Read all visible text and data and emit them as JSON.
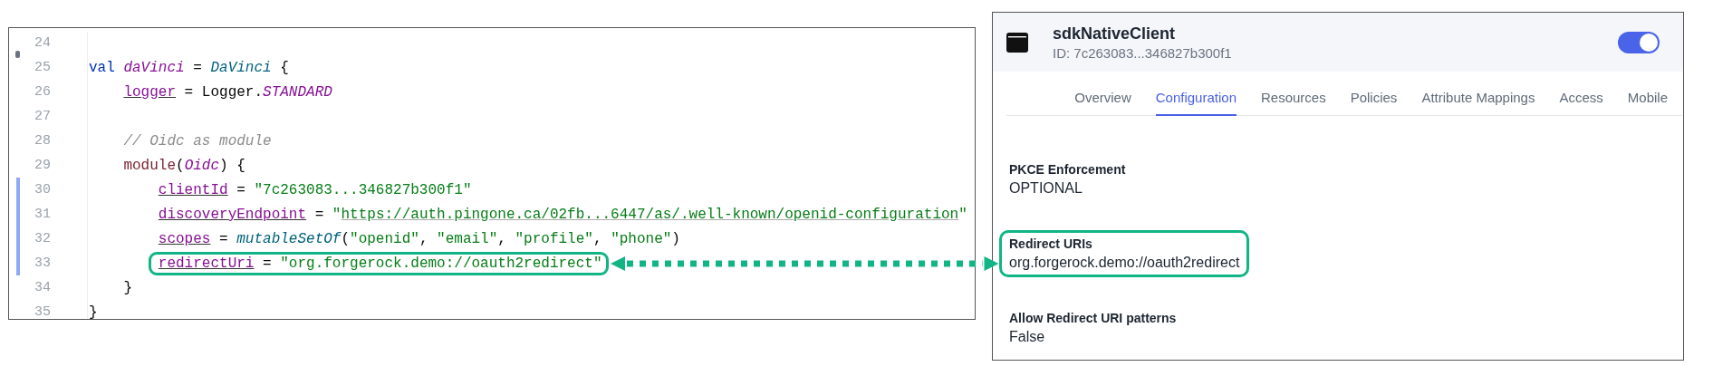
{
  "editor": {
    "lines": [
      {
        "number": "24",
        "changed": false,
        "highlighted": false
      },
      {
        "number": "25",
        "changed": false,
        "highlighted": false,
        "tokens": [
          {
            "kind": "keyword",
            "text": "val "
          },
          {
            "kind": "variable",
            "text": "daVinci"
          },
          {
            "kind": "plain",
            "text": " = "
          },
          {
            "kind": "call",
            "text": "DaVinci"
          },
          {
            "kind": "plain",
            "text": " {"
          }
        ]
      },
      {
        "number": "26",
        "changed": false,
        "highlighted": false,
        "tokens": [
          {
            "kind": "property",
            "text": "logger"
          },
          {
            "kind": "plain",
            "text": " = Logger."
          },
          {
            "kind": "constant",
            "text": "STANDARD"
          }
        ]
      },
      {
        "number": "27",
        "changed": false,
        "highlighted": false
      },
      {
        "number": "28",
        "changed": false,
        "highlighted": false,
        "tokens": [
          {
            "kind": "comment",
            "text": "// Oidc as module"
          }
        ]
      },
      {
        "number": "29",
        "changed": false,
        "highlighted": false,
        "tokens": [
          {
            "kind": "function",
            "text": "module"
          },
          {
            "kind": "plain",
            "text": "("
          },
          {
            "kind": "constant",
            "text": "Oidc"
          },
          {
            "kind": "plain",
            "text": ") {"
          }
        ]
      },
      {
        "number": "30",
        "changed": true,
        "highlighted": false,
        "tokens": [
          {
            "kind": "property",
            "text": "clientId"
          },
          {
            "kind": "plain",
            "text": " = "
          },
          {
            "kind": "string",
            "text": "\"7c263083...346827b300f1\""
          }
        ]
      },
      {
        "number": "31",
        "changed": true,
        "highlighted": false,
        "tokens": [
          {
            "kind": "property",
            "text": "discoveryEndpoint"
          },
          {
            "kind": "plain",
            "text": " = "
          },
          {
            "kind": "string",
            "text": "\""
          },
          {
            "kind": "url",
            "text": "https://auth.pingone.ca/02fb...6447/as/.well-known/openid-configuration"
          },
          {
            "kind": "string",
            "text": "\""
          }
        ]
      },
      {
        "number": "32",
        "changed": true,
        "highlighted": false,
        "tokens": [
          {
            "kind": "property",
            "text": "scopes"
          },
          {
            "kind": "plain",
            "text": " = "
          },
          {
            "kind": "call",
            "text": "mutableSetOf"
          },
          {
            "kind": "plain",
            "text": "("
          },
          {
            "kind": "string",
            "text": "\"openid\""
          },
          {
            "kind": "plain",
            "text": ", "
          },
          {
            "kind": "string",
            "text": "\"email\""
          },
          {
            "kind": "plain",
            "text": ", "
          },
          {
            "kind": "string",
            "text": "\"profile\""
          },
          {
            "kind": "plain",
            "text": ", "
          },
          {
            "kind": "string",
            "text": "\"phone\""
          },
          {
            "kind": "plain",
            "text": ")"
          }
        ]
      },
      {
        "number": "33",
        "changed": true,
        "highlighted": true,
        "tokens": [
          {
            "kind": "property",
            "text": "redirectUri"
          },
          {
            "kind": "plain",
            "text": " = "
          },
          {
            "kind": "string",
            "text": "\"org.forgerock.demo://oauth2redirect\""
          }
        ]
      },
      {
        "number": "34",
        "changed": false,
        "highlighted": false,
        "tokens": [
          {
            "kind": "plain",
            "text": "}"
          }
        ]
      },
      {
        "number": "35",
        "changed": false,
        "highlighted": false,
        "tokens": [
          {
            "kind": "plain",
            "text": "}"
          }
        ]
      }
    ]
  },
  "app": {
    "name": "sdkNativeClient",
    "id": "ID: 7c263083...346827b300f1",
    "enabled": true
  },
  "tabs": [
    {
      "label": "Overview",
      "selected": false
    },
    {
      "label": "Configuration",
      "selected": true
    },
    {
      "label": "Resources",
      "selected": false
    },
    {
      "label": "Policies",
      "selected": false
    },
    {
      "label": "Attribute Mappings",
      "selected": false
    },
    {
      "label": "Access",
      "selected": false
    },
    {
      "label": "Mobile",
      "selected": false
    }
  ],
  "fields": [
    {
      "label": "PKCE Enforcement",
      "value": "OPTIONAL",
      "highlighted": false
    },
    {
      "label": "Redirect URIs",
      "value": "org.forgerock.demo://oauth2redirect",
      "highlighted": true
    },
    {
      "label": "Allow Redirect URI patterns",
      "value": "False",
      "highlighted": false
    }
  ]
}
